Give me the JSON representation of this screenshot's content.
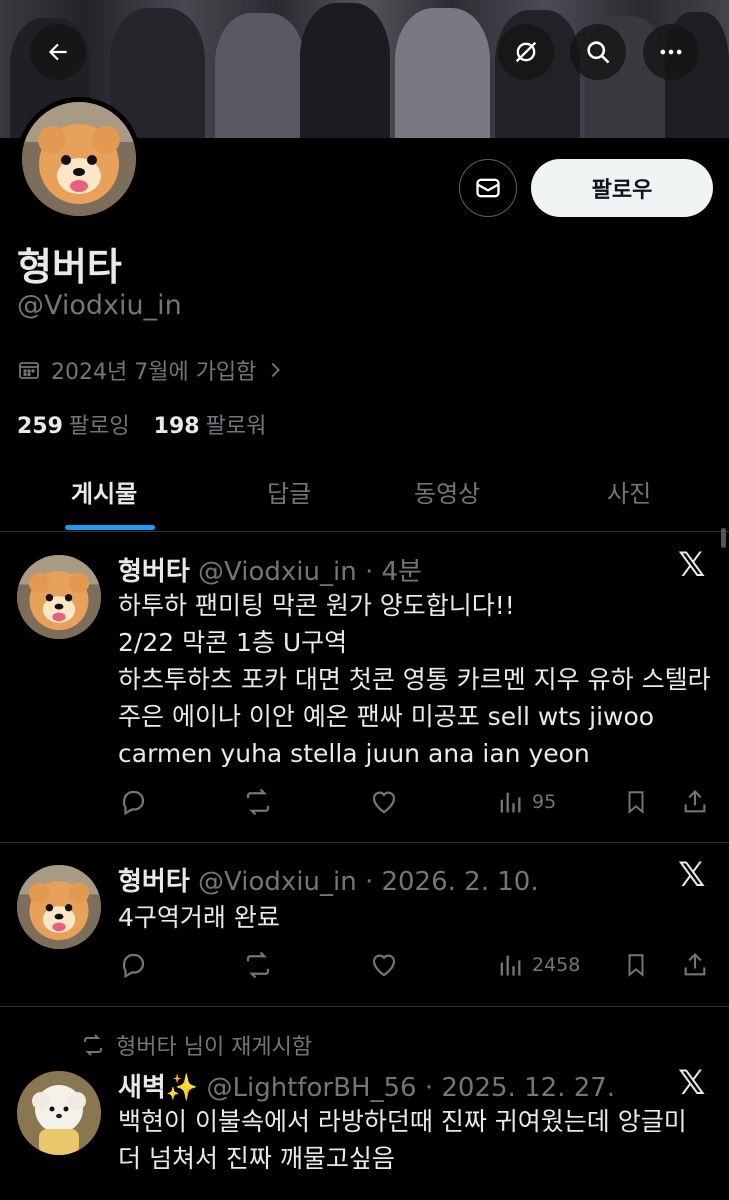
{
  "header": {
    "back_icon": "arrow-left-icon",
    "hide_icon": "eye-slash-icon",
    "search_icon": "search-icon",
    "more_icon": "more-icon"
  },
  "profile": {
    "name": "형버타",
    "handle": "@Viodxiu_in",
    "joined": "2024년 7월에 가입함",
    "following_count": "259",
    "following_label": "팔로잉",
    "followers_count": "198",
    "followers_label": "팔로워",
    "follow_button": "팔로우"
  },
  "tabs": [
    {
      "label": "게시물",
      "active": true
    },
    {
      "label": "답글",
      "active": false
    },
    {
      "label": "동영상",
      "active": false
    },
    {
      "label": "사진",
      "active": false
    }
  ],
  "posts": [
    {
      "author": "형버타",
      "handle": "@Viodxiu_in",
      "time": "· 4분",
      "text": "하투하 팬미팅 막콘 원가 양도합니다!!\n2/22 막콘 1층 U구역\n하츠투하츠 포카 대면 첫콘 영통 카르멘 지우 유하 스텔라 주은 에이나 이안 예온 팬싸 미공포 sell wts jiwoo carmen yuha stella juun ana ian yeon",
      "views": "95",
      "logo": "𝕏"
    },
    {
      "author": "형버타",
      "handle": "@Viodxiu_in",
      "time": "· 2026. 2. 10.",
      "text": "4구역거래 완료",
      "views": "2458",
      "logo": "𝕏"
    },
    {
      "repost_note": "형버타 님이 재게시함",
      "author": "새벽✨",
      "handle": "@LightforBH_56",
      "time": "· 2025. 12. 27.",
      "text": "백현이 이불속에서 라방하던때 진짜 귀여웠는데 앙글미 더 넘쳐서 진짜 깨물고싶음",
      "logo": "𝕏"
    }
  ],
  "colors": {
    "accent": "#1d9bf0",
    "muted": "#71767b",
    "text": "#e7e9ea",
    "bg": "#000000"
  }
}
